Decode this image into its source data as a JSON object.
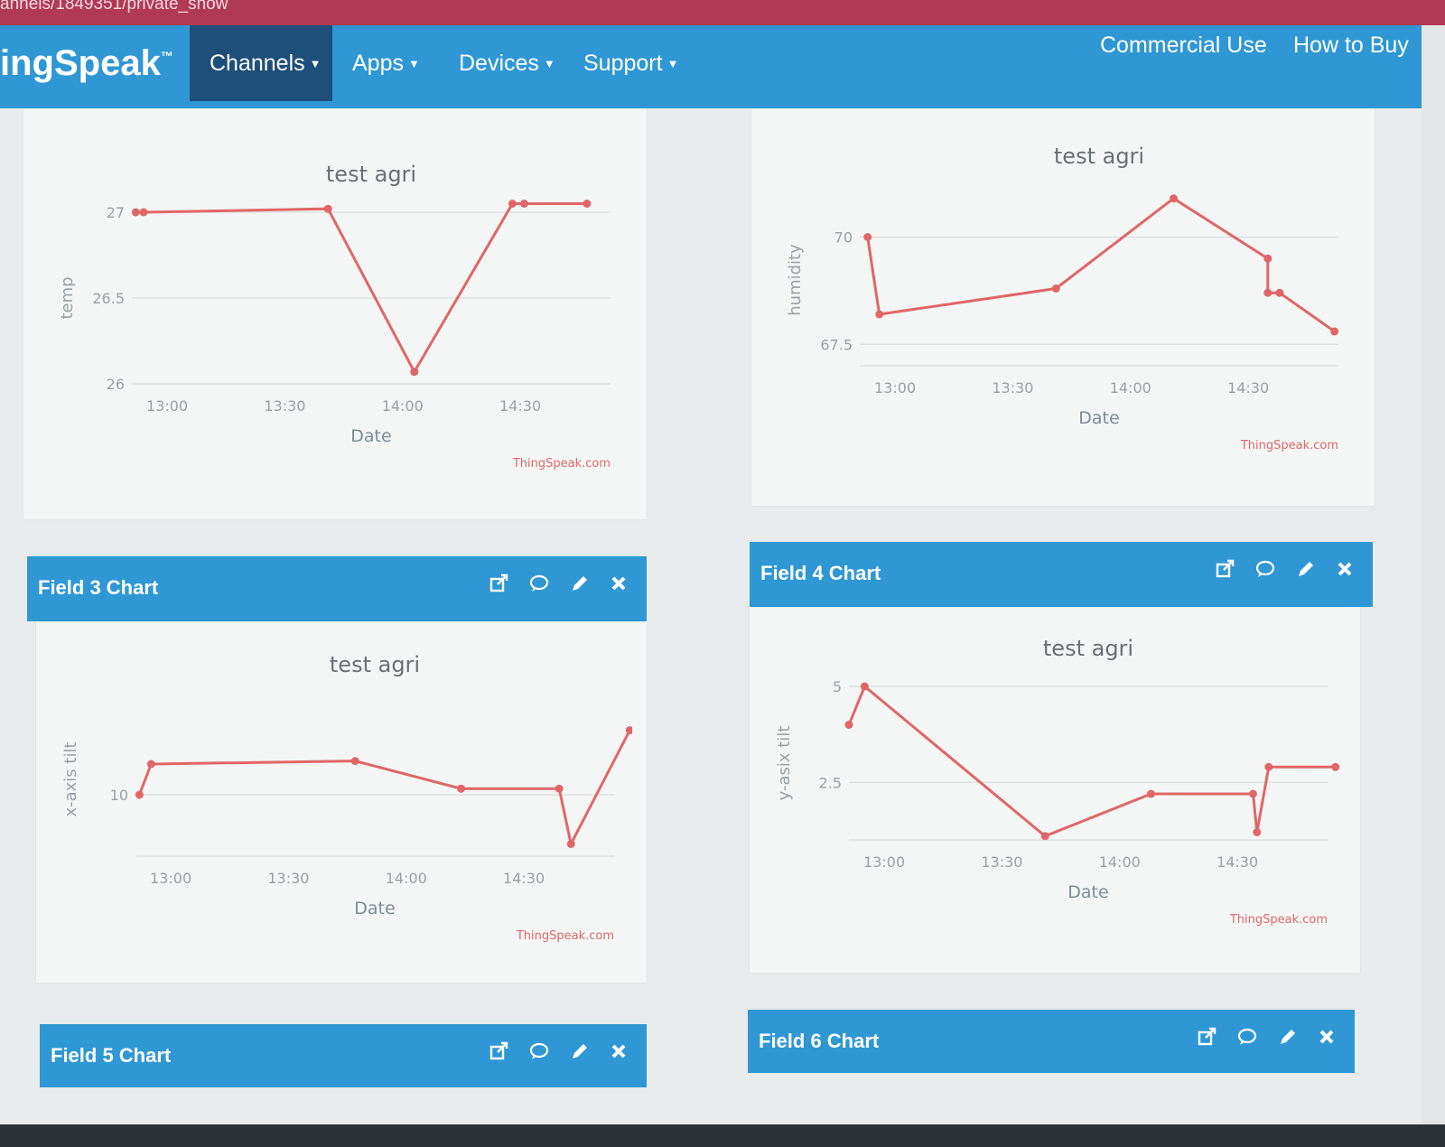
{
  "browser": {
    "url_fragment": "annels/1849351/private_show"
  },
  "nav": {
    "brand": "ingSpeak",
    "brand_tm": "™",
    "items": [
      "Channels",
      "Apps",
      "Devices",
      "Support"
    ],
    "right_items": [
      "Commercial Use",
      "How to Buy"
    ]
  },
  "panels": {
    "field3": {
      "title": "Field 3 Chart"
    },
    "field4": {
      "title": "Field 4 Chart"
    },
    "field5": {
      "title": "Field 5 Chart"
    },
    "field6": {
      "title": "Field 6 Chart"
    }
  },
  "colors": {
    "header_blue": "#2f97d4",
    "active_nav": "#1e4f7a",
    "line": "#e06668",
    "url_bar": "#b03a55"
  },
  "chart_data": [
    {
      "type": "line",
      "title": "test agri",
      "xlabel": "Date",
      "ylabel": "temp",
      "credit": "ThingSpeak.com",
      "x_ticks": [
        "13:00",
        "13:30",
        "14:00",
        "14:30"
      ],
      "y_ticks": [
        "26",
        "26.5",
        "27"
      ],
      "ylim": [
        26,
        27
      ],
      "xlim": [
        "12:51",
        "14:53"
      ],
      "x": [
        "12:52",
        "12:54",
        "13:41",
        "14:03",
        "14:28",
        "14:31",
        "14:47"
      ],
      "y": [
        27.0,
        27.0,
        27.02,
        26.07,
        27.05,
        27.05,
        27.05
      ]
    },
    {
      "type": "line",
      "title": "test agri",
      "xlabel": "Date",
      "ylabel": "humidity",
      "credit": "ThingSpeak.com",
      "x_ticks": [
        "13:00",
        "13:30",
        "14:00",
        "14:30"
      ],
      "y_ticks": [
        "67.5",
        "70"
      ],
      "ylim": [
        67,
        71
      ],
      "xlim": [
        "12:51",
        "14:53"
      ],
      "x": [
        "12:53",
        "12:56",
        "13:41",
        "14:11",
        "14:35",
        "14:35",
        "14:38",
        "14:52"
      ],
      "y": [
        70.0,
        68.2,
        68.8,
        70.9,
        69.5,
        68.7,
        68.7,
        67.8
      ]
    },
    {
      "type": "line",
      "title": "test agri",
      "xlabel": "Date",
      "ylabel": "x-axis tilt",
      "credit": "ThingSpeak.com",
      "x_ticks": [
        "13:00",
        "13:30",
        "14:00",
        "14:30"
      ],
      "y_ticks": [
        "10"
      ],
      "ylim": [
        8,
        13
      ],
      "xlim": [
        "12:51",
        "14:53"
      ],
      "x": [
        "12:52",
        "12:55",
        "13:47",
        "14:14",
        "14:39",
        "14:42",
        "14:57"
      ],
      "y": [
        10,
        11,
        11.1,
        10.2,
        10.2,
        8.4,
        12.1
      ]
    },
    {
      "type": "line",
      "title": "test agri",
      "xlabel": "Date",
      "ylabel": "y-asix tilt",
      "credit": "ThingSpeak.com",
      "x_ticks": [
        "13:00",
        "13:30",
        "14:00",
        "14:30"
      ],
      "y_ticks": [
        "2.5",
        "5"
      ],
      "ylim": [
        1,
        5
      ],
      "xlim": [
        "12:51",
        "14:53"
      ],
      "x": [
        "12:51",
        "12:55",
        "13:41",
        "14:08",
        "14:34",
        "14:35",
        "14:38",
        "14:55"
      ],
      "y": [
        4,
        5,
        1.1,
        2.2,
        2.2,
        1.2,
        2.9,
        2.9
      ]
    }
  ]
}
